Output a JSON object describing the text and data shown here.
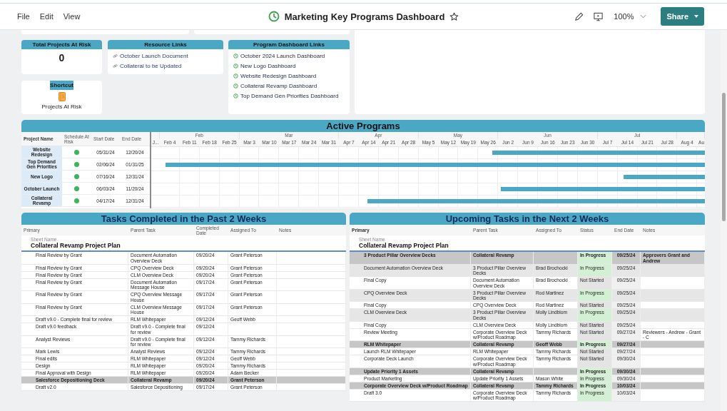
{
  "menu": [
    "File",
    "Edit",
    "View"
  ],
  "title": "Marketing Key Programs Dashboard",
  "zoom": "100%",
  "share_button": "Share",
  "widgets": {
    "total_at_risk": {
      "header": "Total Projects At Risk",
      "value": "0"
    },
    "shortcut": {
      "header": "Shortcut",
      "label": "Projects At Risk"
    },
    "resource_links": {
      "header": "Resource Links",
      "links": [
        "October Launch Document",
        "Collateral to be Updated"
      ]
    },
    "program_links": {
      "header": "Program Dashboard Links",
      "links": [
        "October 2024 Launch Dashboard",
        "New Logo Dashboard",
        "Website Redesign Dashboard",
        "Collateral Revamp Dashboard",
        "Top Demand Gen Priorities Dashboard"
      ]
    }
  },
  "gantt": {
    "title": "Active Programs",
    "columns": [
      "Project Name",
      "Schedule At Risk",
      "Start Date",
      "End Date"
    ],
    "months": [
      {
        "weeks": [
          "J..."
        ]
      },
      {
        "label": "Feb",
        "weeks": [
          "Feb 4",
          "Feb 11",
          "Feb 18",
          "Feb 25"
        ]
      },
      {
        "label": "Mar",
        "weeks": [
          "Mar 3",
          "Mar 10",
          "Mar 17",
          "Mar 24",
          "Mar 31"
        ]
      },
      {
        "label": "Apr",
        "weeks": [
          "Apr 7",
          "Apr 14",
          "Apr 21",
          "Apr 28"
        ]
      },
      {
        "label": "May",
        "weeks": [
          "May 5",
          "May 12",
          "May 19",
          "May 26"
        ]
      },
      {
        "label": "Jun",
        "weeks": [
          "Jun 2",
          "Jun 9",
          "Jun 16",
          "Jun 23",
          "Jun 30"
        ]
      },
      {
        "label": "Jul",
        "weeks": [
          "Jul 7",
          "Jul 14",
          "Jul 21",
          "Jul 28"
        ]
      },
      {
        "weeks": [
          "Aug 4",
          "Au"
        ]
      }
    ],
    "rows": [
      {
        "name": "Website Redesign",
        "at_risk": false,
        "start": "05/31/24",
        "end": "12/20/24"
      },
      {
        "name": "Top Demand Gen Priorities",
        "at_risk": false,
        "start": "02/06/24",
        "end": "01/31/25"
      },
      {
        "name": "New Logo",
        "at_risk": false,
        "start": "07/16/24",
        "end": "12/31/24"
      },
      {
        "name": "October Launch",
        "at_risk": false,
        "start": "06/03/24",
        "end": "11/20/24"
      },
      {
        "name": "Collateral Revamp",
        "at_risk": false,
        "start": "04/17/24",
        "end": "12/31/24"
      }
    ]
  },
  "completed": {
    "title": "Tasks Completed in the Past 2 Weeks",
    "columns": [
      "Primary",
      "Parent Task",
      "Completed Date",
      "Assigned To",
      "Notes"
    ],
    "sheet_label": "Sheet Name",
    "sheet_name": "Collateral Revamp Project Plan",
    "rows": [
      {
        "kind": "task",
        "primary": "Final Review by Grant",
        "parent": "Document Automation Overview Deck",
        "date": "09/20/24",
        "assigned": "Grant Peterson"
      },
      {
        "kind": "task",
        "primary": "Final Review by Grant",
        "parent": "CPQ Overview Deck",
        "date": "09/20/24",
        "assigned": "Grant Peterson"
      },
      {
        "kind": "task",
        "primary": "Final Review by Grant",
        "parent": "CLM Overview Deck",
        "date": "09/20/24",
        "assigned": "Grant Peterson"
      },
      {
        "kind": "task",
        "primary": "Final Review by Grant",
        "parent": "Document Automation Message House",
        "date": "09/17/24",
        "assigned": "Grant Peterson"
      },
      {
        "kind": "task",
        "primary": "Final Review by Grant",
        "parent": "CPQ Overview Message House",
        "date": "09/17/24",
        "assigned": "Grant Peterson"
      },
      {
        "kind": "task",
        "primary": "Final Review by Grant",
        "parent": "CLM Overview Message House",
        "date": "09/17/24",
        "assigned": "Grant Peterson"
      },
      {
        "kind": "task",
        "primary": "Draft v9.0 - Complete final for review",
        "parent": "RLM Whitepaper",
        "date": "09/12/24",
        "assigned": "Geoff Webb"
      },
      {
        "kind": "task",
        "primary": "Draft v9.0 feedback",
        "parent": "Draft v9.0 - Complete final for review",
        "date": "09/12/24"
      },
      {
        "kind": "task",
        "primary": "Analyst Reviews",
        "parent": "Draft v9.0 - Complete final for review",
        "date": "09/12/24",
        "assigned": "Tammy Richards"
      },
      {
        "kind": "task",
        "primary": "Mark Lewis",
        "parent": "Analyst Reviews",
        "date": "09/12/24",
        "assigned": "Tammy Richards"
      },
      {
        "kind": "task",
        "primary": "Final edits",
        "parent": "RLM Whitepaper",
        "date": "09/12/24",
        "assigned": "Geoff Webb"
      },
      {
        "kind": "task",
        "primary": "Design",
        "parent": "RLM Whitepaper",
        "date": "09/20/24",
        "assigned": "Tammy Richards"
      },
      {
        "kind": "task",
        "primary": "Final Approval with Design",
        "parent": "RLM Whitepaper",
        "date": "09/20/24",
        "assigned": "Adam Becker"
      },
      {
        "kind": "group",
        "primary": "Salesforce Depositioning Deck",
        "parent": "Collateral Revamp",
        "date": "09/20/24",
        "assigned": "Grant Peterson"
      },
      {
        "kind": "task",
        "primary": "Draft v2.0",
        "parent": "Salesforce Depositioning",
        "date": "09/17/24",
        "assigned": "Grant Peterson"
      }
    ]
  },
  "upcoming": {
    "title": "Upcoming Tasks in the Next 2 Weeks",
    "columns": [
      "Primary",
      "Parent Task",
      "Assigned To",
      "Status",
      "End Date",
      "Notes"
    ],
    "sheet_label": "Sheet Name",
    "sheet_name": "Collateral Revamp Project Plan",
    "rows": [
      {
        "kind": "group",
        "primary": "3 Product Pillar Overview Decks",
        "parent": "Collateral Revamp",
        "status": "In Progress",
        "in_progress": true,
        "end": "09/25/24",
        "notes": "Approvers Grant and Andrew"
      },
      {
        "kind": "subgroup",
        "primary": "Document Automation Overview Deck",
        "parent": "3 Product Pillar Overview Decks",
        "assigned": "Brad Brochocki",
        "status": "In Progress",
        "in_progress": true,
        "end": "09/25/24"
      },
      {
        "kind": "task",
        "primary": "Final Copy",
        "parent": "Document Automation Overview Deck",
        "assigned": "Brad Brochocki",
        "status": "Not Started",
        "in_progress": false,
        "end": "09/25/24"
      },
      {
        "kind": "subgroup",
        "primary": "CPQ Overview Deck",
        "parent": "3 Product Pillar Overview Decks",
        "assigned": "Rod Martinez",
        "status": "In Progress",
        "in_progress": true,
        "end": "09/25/24"
      },
      {
        "kind": "task",
        "primary": "Final Copy",
        "parent": "CPQ Overview Deck",
        "assigned": "Rod Martinez",
        "status": "Not Started",
        "in_progress": false,
        "end": "09/25/24"
      },
      {
        "kind": "subgroup",
        "primary": "CLM Overview Deck",
        "parent": "3 Product Pillar Overview Decks",
        "assigned": "Molly Lindblom",
        "status": "In Progress",
        "in_progress": true,
        "end": "09/25/24"
      },
      {
        "kind": "task",
        "primary": "Final Copy",
        "parent": "CLM Overview Deck",
        "assigned": "Molly Lindblom",
        "status": "Not Started",
        "in_progress": false,
        "end": "09/25/24"
      },
      {
        "kind": "task",
        "primary": "Review Meeting",
        "parent": "Corporate Overview Deck w/Product Roadmap",
        "assigned": "Tammy Richards",
        "status": "Not Started",
        "in_progress": false,
        "end": "09/27/24",
        "notes": "Reviewers - Andrew - Grant - C"
      },
      {
        "kind": "group",
        "primary": "RLM Whitepaper",
        "parent": "Collateral Revamp",
        "assigned": "Geoff Webb",
        "status": "In Progress",
        "in_progress": true,
        "end": "09/27/24"
      },
      {
        "kind": "task",
        "primary": "Launch RLM Whitepaper",
        "parent": "RLM Whitepaper",
        "assigned": "Tammy Richards",
        "status": "Not Started",
        "in_progress": false,
        "end": "09/27/24"
      },
      {
        "kind": "task",
        "primary": "Corporate Deck Launch",
        "parent": "Corporate Overview Deck w/Product Roadmap",
        "assigned": "Tammy Richards",
        "status": "Not Started",
        "in_progress": false,
        "end": "09/30/24"
      },
      {
        "kind": "group",
        "primary": "Update Priority 1 Assets",
        "parent": "Collateral Revamp",
        "status": "In Progress",
        "in_progress": true,
        "end": "09/30/24"
      },
      {
        "kind": "task",
        "primary": "Product Marketing",
        "parent": "Update Priority 1 Assets",
        "assigned": "Mason White",
        "status": "In Progress",
        "in_progress": true,
        "end": "09/30/24"
      },
      {
        "kind": "group",
        "primary": "Corporate Overview Deck w/Product Roadmap",
        "parent": "Collateral Revamp",
        "assigned": "Tammy Richards",
        "status": "In Progress",
        "in_progress": true,
        "end": "10/03/24"
      },
      {
        "kind": "task",
        "primary": "Draft 3.0",
        "parent": "Corporate Overview Deck w/Product Roadmap",
        "assigned": "Tammy Richards",
        "status": "In Progress",
        "in_progress": true,
        "end": "10/03/24"
      }
    ]
  }
}
